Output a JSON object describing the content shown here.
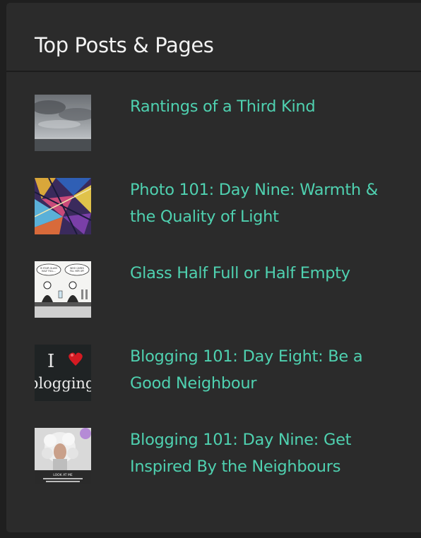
{
  "widget": {
    "title": "Top Posts & Pages",
    "colors": {
      "background": "#2b2b2b",
      "title": "#f2f2f2",
      "link": "#4fd1b0"
    }
  },
  "posts": [
    {
      "title": "Rantings of a Third Kind",
      "thumbnail_icon": "cloudy-sea-photo"
    },
    {
      "title": "Photo 101: Day Nine: Warmth &\nthe Quality of Light",
      "thumbnail_icon": "colorful-glass-photo"
    },
    {
      "title": "Glass Half Full or Half Empty",
      "thumbnail_icon": "bar-cartoon-image"
    },
    {
      "title": "Blogging 101: Day Eight: Be a\nGood Neighbour",
      "thumbnail_icon": "i-love-blogging-image"
    },
    {
      "title": "Blogging 101: Day Nine: Get\nInspired By the Neighbours",
      "thumbnail_icon": "portrait-poster-image"
    }
  ],
  "thumbnail_text": {
    "cartoon_left": "IS YOUR GLASS HALF FULL OR HALF EMPTY?",
    "cartoon_right": "WHO CARES BOB, FILL HER UP!",
    "blog_i": "I",
    "blog_word": "blogging",
    "poster_caption": "LOOK AT ME"
  }
}
